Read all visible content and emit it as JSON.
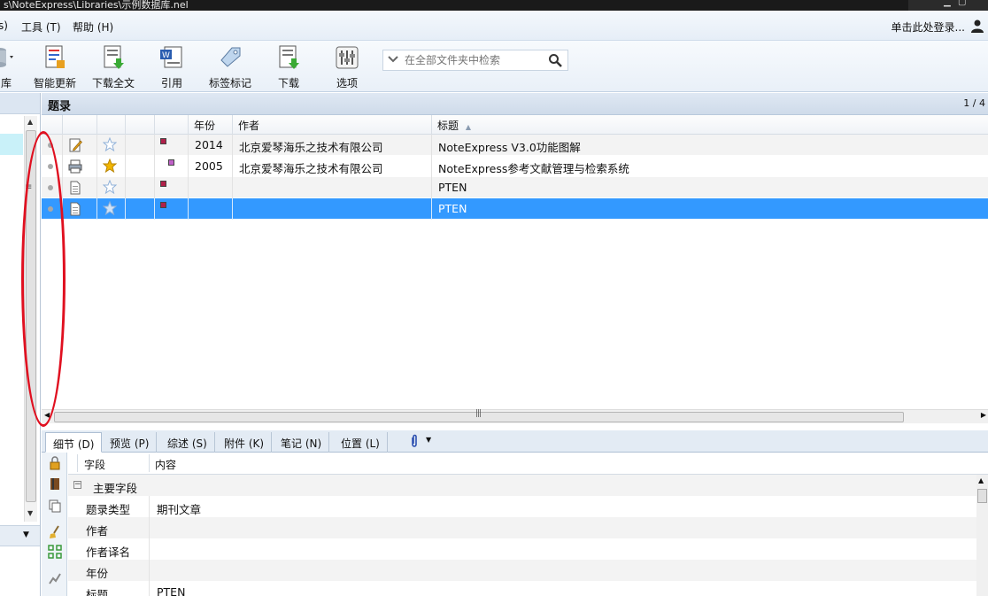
{
  "window": {
    "path": "s\\NoteExpress\\Libraries\\示例数据库.nel"
  },
  "menu": {
    "items": [
      {
        "label": "s)"
      },
      {
        "label": "工具 (T)"
      },
      {
        "label": "帮助 (H)"
      }
    ],
    "login": "单击此处登录..."
  },
  "toolbar": {
    "buttons": [
      {
        "label": "库"
      },
      {
        "label": "智能更新"
      },
      {
        "label": "下载全文"
      },
      {
        "label": "引用"
      },
      {
        "label": "标签标记"
      },
      {
        "label": "下载"
      },
      {
        "label": "选项"
      }
    ],
    "search_placeholder": "在全部文件夹中检索"
  },
  "records": {
    "title": "题录",
    "page": "1 / 4",
    "columns": [
      "年份",
      "作者",
      "标题"
    ],
    "rows": [
      {
        "year": "2014",
        "author": "北京爱琴海乐之技术有限公司",
        "title": "NoteExpress V3.0功能图解",
        "icon": "edit-note-icon",
        "starred": false,
        "flag_color": "#b0204a"
      },
      {
        "year": "2005",
        "author": "北京爱琴海乐之技术有限公司",
        "title": "NoteExpress参考文献管理与检索系统",
        "icon": "printer-icon",
        "starred": true,
        "flag_color": "#c060c8"
      },
      {
        "year": "",
        "author": "",
        "title": "PTEN",
        "icon": "document-icon",
        "starred": false,
        "flag_color": "#b0204a"
      },
      {
        "year": "",
        "author": "",
        "title": "PTEN",
        "icon": "document-icon",
        "starred": false,
        "flag_color": "#b0204a",
        "selected": true
      }
    ]
  },
  "detail_tabs": [
    {
      "label": "细节 (D)",
      "active": true
    },
    {
      "label": "预览 (P)"
    },
    {
      "label": "综述 (S)"
    },
    {
      "label": "附件 (K)"
    },
    {
      "label": "笔记 (N)"
    },
    {
      "label": "位置 (L)"
    }
  ],
  "details": {
    "columns": [
      "字段",
      "内容"
    ],
    "group": "主要字段",
    "fields": [
      {
        "key": "题录类型",
        "value": "期刊文章"
      },
      {
        "key": "作者",
        "value": ""
      },
      {
        "key": "作者译名",
        "value": ""
      },
      {
        "key": "年份",
        "value": ""
      },
      {
        "key": "标题",
        "value": "PTEN"
      }
    ]
  },
  "colors": {
    "selection": "#3399ff",
    "annotation": "#e01020",
    "star_gold": "#f2b600",
    "star_blue": "#8fb0d8"
  }
}
